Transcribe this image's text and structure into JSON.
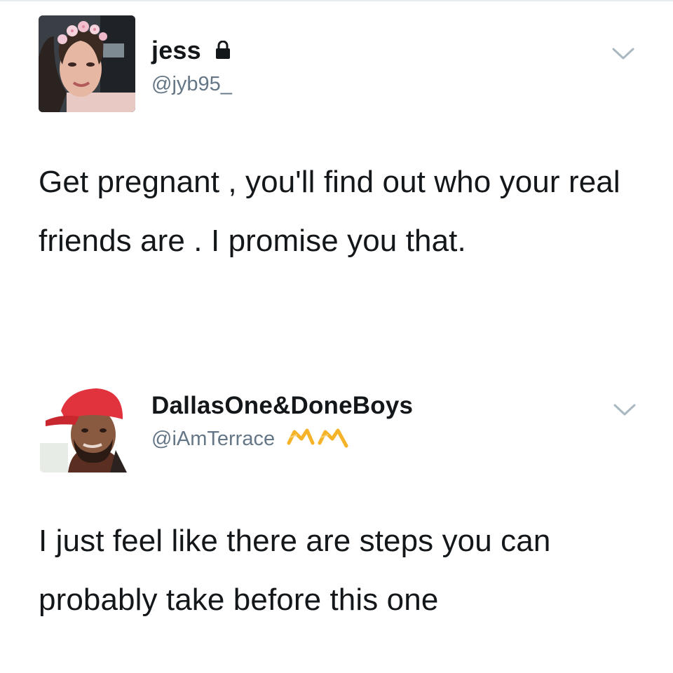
{
  "tweets": [
    {
      "display_name": "jess",
      "handle": "@jyb95_",
      "protected": true,
      "avatar_icon": "profile-photo",
      "menu_icon": "chevron-down-icon",
      "text": "Get pregnant , you'll find out who your real friends are . I promise you that."
    },
    {
      "display_name": "DallasOne&DoneBoys",
      "handle": "@iAmTerrace",
      "handle_badge_icon": "crown-emoji",
      "avatar_icon": "profile-photo",
      "menu_icon": "chevron-down-icon",
      "text": "I just feel like there are steps you can probably take before this one"
    }
  ],
  "colors": {
    "text": "#14171a",
    "handle": "#657786",
    "chevron": "#aab8c2",
    "badge": "#f5b32a"
  }
}
